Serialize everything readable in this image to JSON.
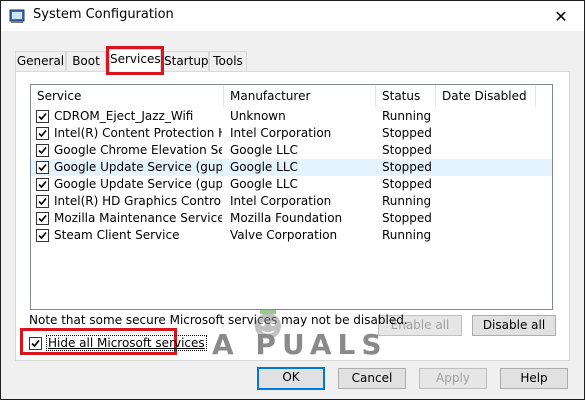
{
  "window": {
    "title": "System Configuration",
    "close_glyph": "✕"
  },
  "tabs": [
    {
      "label": "General"
    },
    {
      "label": "Boot"
    },
    {
      "label": "Services"
    },
    {
      "label": "Startup"
    },
    {
      "label": "Tools"
    }
  ],
  "active_tab": "Services",
  "columns": [
    "Service",
    "Manufacturer",
    "Status",
    "Date Disabled"
  ],
  "services": [
    {
      "name": "CDROM_Eject_Jazz_Wifi",
      "manufacturer": "Unknown",
      "status": "Running",
      "date_disabled": "",
      "checked": true
    },
    {
      "name": "Intel(R) Content Protection HEC...",
      "manufacturer": "Intel Corporation",
      "status": "Stopped",
      "date_disabled": "",
      "checked": true
    },
    {
      "name": "Google Chrome Elevation Servic...",
      "manufacturer": "Google LLC",
      "status": "Stopped",
      "date_disabled": "",
      "checked": true
    },
    {
      "name": "Google Update Service (gupdate)",
      "manufacturer": "Google LLC",
      "status": "Stopped",
      "date_disabled": "",
      "checked": true
    },
    {
      "name": "Google Update Service (gupdatem)",
      "manufacturer": "Google LLC",
      "status": "Stopped",
      "date_disabled": "",
      "checked": true
    },
    {
      "name": "Intel(R) HD Graphics Control Pa...",
      "manufacturer": "Intel Corporation",
      "status": "Running",
      "date_disabled": "",
      "checked": true
    },
    {
      "name": "Mozilla Maintenance Service",
      "manufacturer": "Mozilla Foundation",
      "status": "Stopped",
      "date_disabled": "",
      "checked": true
    },
    {
      "name": "Steam Client Service",
      "manufacturer": "Valve Corporation",
      "status": "Running",
      "date_disabled": "",
      "checked": true
    }
  ],
  "note": "Note that some secure Microsoft services may not be disabled.",
  "buttons": {
    "enable_all": "Enable all",
    "disable_all": "Disable all",
    "ok": "OK",
    "cancel": "Cancel",
    "apply": "Apply",
    "help": "Help"
  },
  "hide_ms": {
    "label": "Hide all Microsoft services",
    "checked": true
  },
  "watermark": {
    "text": "A PUALS"
  },
  "colors": {
    "highlight": "#d9141c",
    "selected_row": "#e5f3ff",
    "focus": "#0078d7"
  }
}
